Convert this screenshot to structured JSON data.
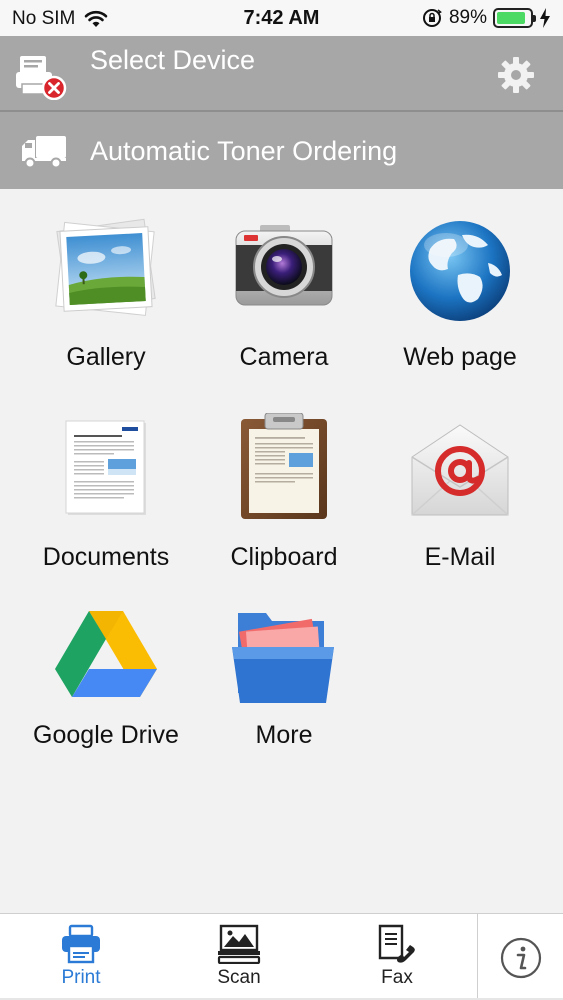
{
  "status_bar": {
    "carrier": "No SIM",
    "time": "7:42 AM",
    "battery_percent": "89%",
    "battery_level": 0.89
  },
  "header": {
    "device_label": "Select Device",
    "toner_label": "Automatic Toner Ordering"
  },
  "grid": {
    "items": [
      {
        "label": "Gallery",
        "icon": "gallery-icon"
      },
      {
        "label": "Camera",
        "icon": "camera-icon"
      },
      {
        "label": "Web page",
        "icon": "globe-icon"
      },
      {
        "label": "Documents",
        "icon": "document-icon"
      },
      {
        "label": "Clipboard",
        "icon": "clipboard-icon"
      },
      {
        "label": "E-Mail",
        "icon": "email-icon"
      },
      {
        "label": "Google Drive",
        "icon": "google-drive-icon"
      },
      {
        "label": "More",
        "icon": "folder-icon"
      }
    ]
  },
  "tabs": [
    {
      "label": "Print",
      "icon": "printer-icon",
      "active": true
    },
    {
      "label": "Scan",
      "icon": "scanner-icon",
      "active": false
    },
    {
      "label": "Fax",
      "icon": "fax-icon",
      "active": false
    }
  ],
  "colors": {
    "header_bg": "#a7a7a7",
    "accent": "#2a7ad6",
    "battery": "#4cd964",
    "error_badge": "#d9262c"
  }
}
